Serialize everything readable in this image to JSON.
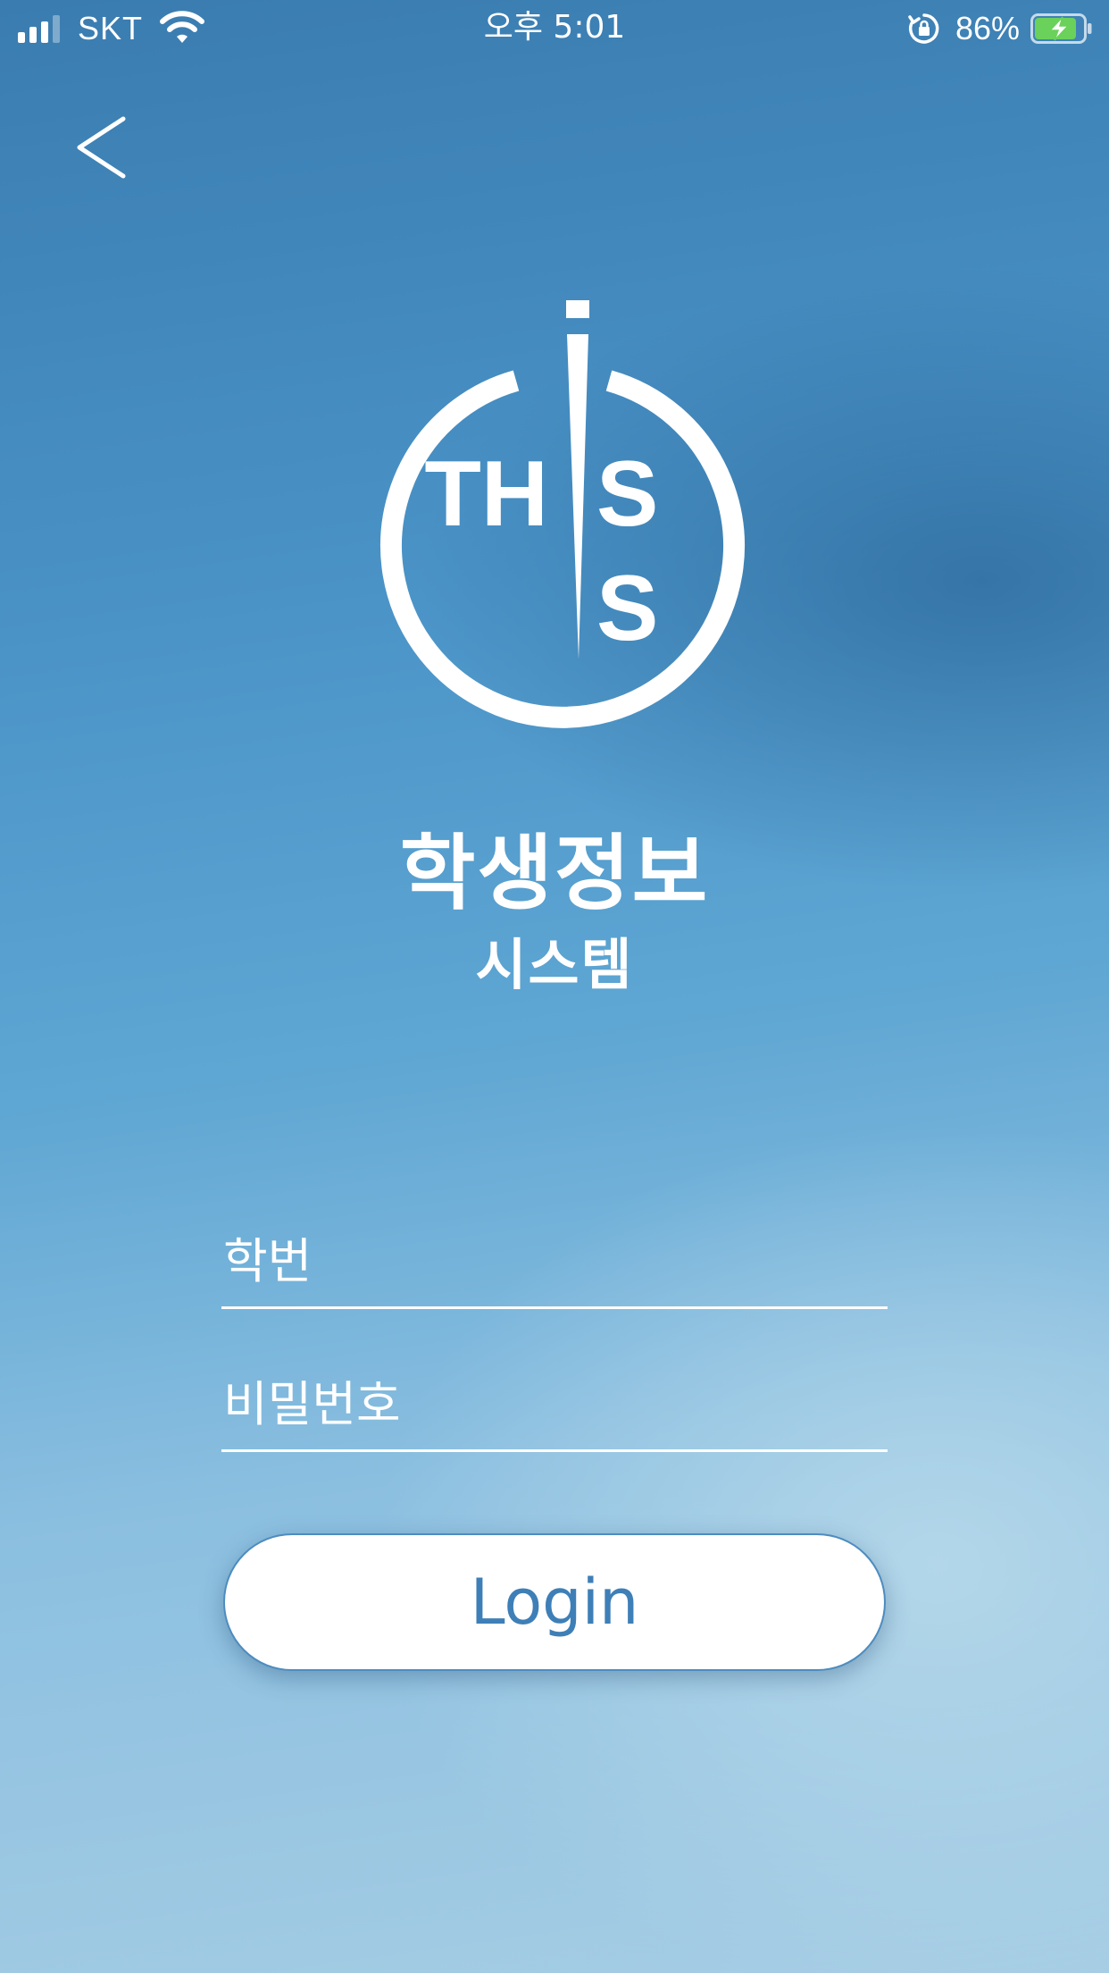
{
  "status_bar": {
    "carrier": "SKT",
    "time": "오후 5:01",
    "battery_percent": "86%",
    "signal_icon": "cellular-signal-icon",
    "wifi_icon": "wifi-icon",
    "orientation_lock_icon": "orientation-lock-icon",
    "battery_icon": "battery-charging-icon",
    "battery_level": 0.86
  },
  "nav": {
    "back_icon": "chevron-left-icon"
  },
  "logo": {
    "letters_top": "TH",
    "letter_s": "S",
    "icon": "this-logo-icon"
  },
  "title": {
    "main": "학생정보",
    "sub": "시스템"
  },
  "form": {
    "student_id": {
      "value": "",
      "placeholder": "학번"
    },
    "password": {
      "value": "",
      "placeholder": "비밀번호"
    },
    "login_label": "Login"
  },
  "colors": {
    "background_top": "#3a7cb0",
    "background_bottom": "#a6cde4",
    "accent": "#3e7fb7",
    "text": "#ffffff",
    "battery_fill": "#6ad15a"
  }
}
